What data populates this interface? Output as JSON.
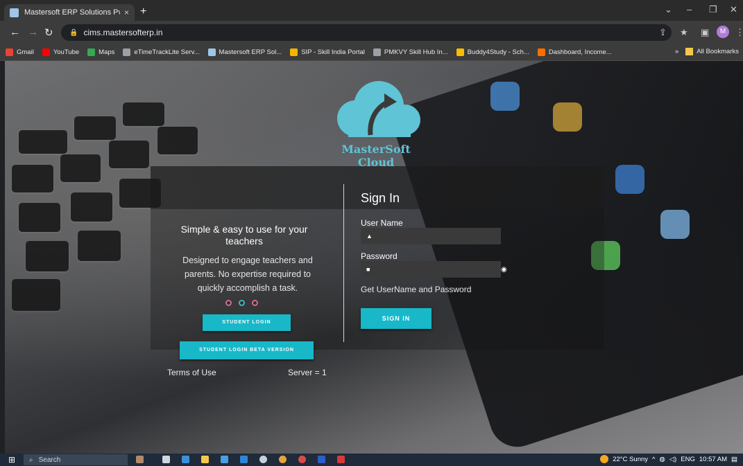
{
  "browser": {
    "tab_title": "Mastersoft ERP Solutions Pvt.Ltd",
    "tab_close": "×",
    "new_tab": "+",
    "url": "cims.mastersofterp.in",
    "profile_initial": "M"
  },
  "bookmarks": [
    {
      "label": "Gmail",
      "color": "#ea4335"
    },
    {
      "label": "YouTube",
      "color": "#ff0000"
    },
    {
      "label": "Maps",
      "color": "#34a853"
    },
    {
      "label": "eTimeTrackLite Serv...",
      "color": "#9aa0a6"
    },
    {
      "label": "Mastersoft ERP Sol...",
      "color": "#9fc5e8"
    },
    {
      "label": "SIP - Skill India Portal",
      "color": "#f4b400"
    },
    {
      "label": "PMKVY Skill Hub In...",
      "color": "#9aa0a6"
    },
    {
      "label": "Buddy4Study - Sch...",
      "color": "#fbbc04"
    },
    {
      "label": "Dashboard, Income...",
      "color": "#ff6d00"
    }
  ],
  "bookmarks_overflow": "»",
  "all_bookmarks": "All Bookmarks",
  "page": {
    "logo_text": "MasterSoft Cloud",
    "tagline": "Simple & easy to use for your teachers",
    "description": "Designed to engage teachers and parents. No expertise required to quickly accomplish a task.",
    "student_login_label": "STUDENT LOGIN",
    "student_login_beta_label": "STUDENT LOGIN BETA VERSION",
    "terms_label": "Terms of Use",
    "server_label": "Server = 1",
    "signin_title": "Sign In",
    "username_label": "User Name",
    "username_value": "",
    "password_label": "Password",
    "password_value": "",
    "get_credentials_link": "Get UserName and Password",
    "signin_button_label": "SIGN IN",
    "carousel_active_index": 1,
    "accent_color": "#18b8c9"
  },
  "taskbar": {
    "search_placeholder": "Search",
    "weather": "22°C  Sunny",
    "language": "ENG",
    "time": "10:57 AM"
  }
}
